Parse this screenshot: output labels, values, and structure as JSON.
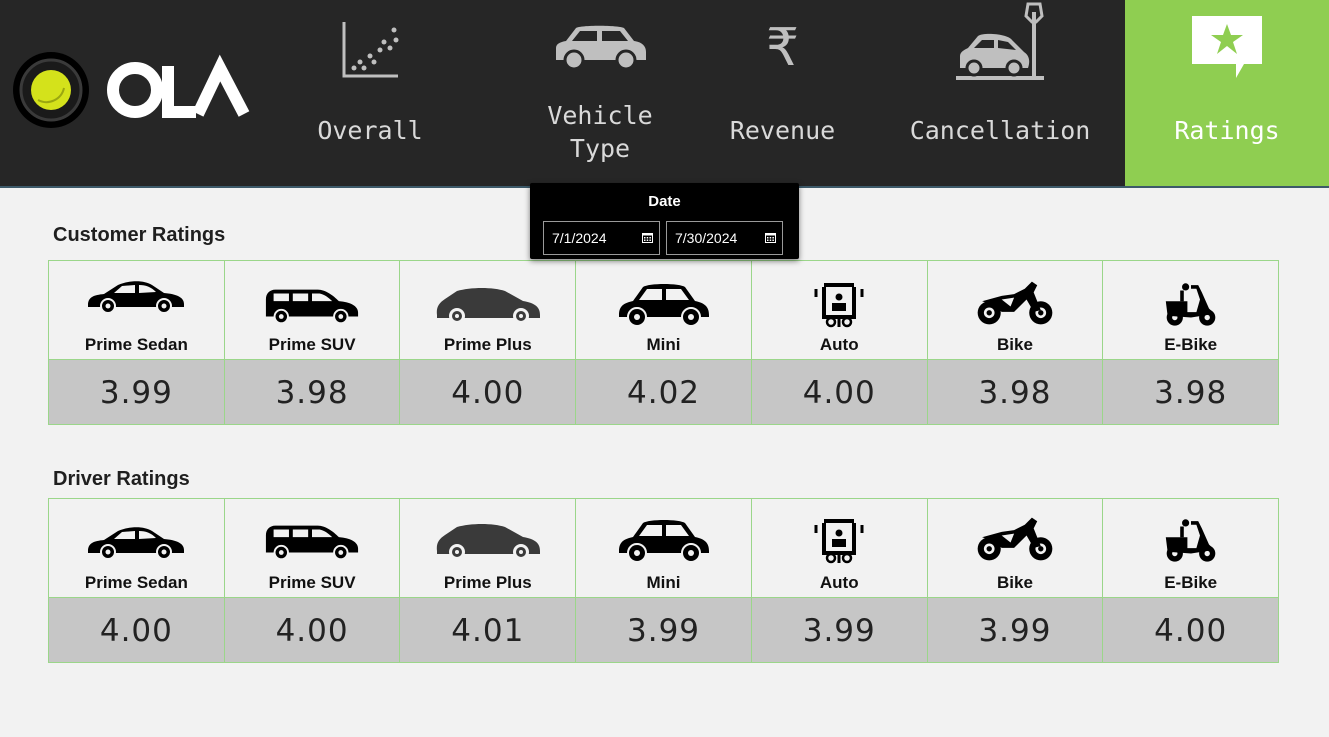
{
  "brand": {
    "name": "OLA"
  },
  "nav": {
    "overall": "Overall",
    "vehicle_line1": "Vehicle",
    "vehicle_line2": "Type",
    "revenue": "Revenue",
    "revenue_symbol": "₹",
    "cancellation": "Cancellation",
    "ratings": "Ratings",
    "active": "Ratings"
  },
  "date_filter": {
    "title": "Date",
    "start": "7/1/2024",
    "end": "7/30/2024"
  },
  "customer_ratings": {
    "title": "Customer Ratings",
    "items": [
      {
        "label": "Prime Sedan",
        "value": "3.99",
        "icon": "sedan-icon"
      },
      {
        "label": "Prime SUV",
        "value": "3.98",
        "icon": "suv-icon"
      },
      {
        "label": "Prime Plus",
        "value": "4.00",
        "icon": "prime-plus-car-icon"
      },
      {
        "label": "Mini",
        "value": "4.02",
        "icon": "mini-car-icon"
      },
      {
        "label": "Auto",
        "value": "4.00",
        "icon": "auto-rickshaw-icon"
      },
      {
        "label": "Bike",
        "value": "3.98",
        "icon": "motorbike-icon"
      },
      {
        "label": "E-Bike",
        "value": "3.98",
        "icon": "scooter-icon"
      }
    ]
  },
  "driver_ratings": {
    "title": "Driver Ratings",
    "items": [
      {
        "label": "Prime Sedan",
        "value": "4.00",
        "icon": "sedan-icon"
      },
      {
        "label": "Prime SUV",
        "value": "4.00",
        "icon": "suv-icon"
      },
      {
        "label": "Prime Plus",
        "value": "4.01",
        "icon": "prime-plus-car-icon"
      },
      {
        "label": "Mini",
        "value": "3.99",
        "icon": "mini-car-icon"
      },
      {
        "label": "Auto",
        "value": "3.99",
        "icon": "auto-rickshaw-icon"
      },
      {
        "label": "Bike",
        "value": "3.99",
        "icon": "motorbike-icon"
      },
      {
        "label": "E-Bike",
        "value": "4.00",
        "icon": "scooter-icon"
      }
    ]
  },
  "colors": {
    "header_bg": "#262626",
    "active_tab": "#8fce51",
    "grid_border": "#9bd68a",
    "value_bg": "#c6c6c6",
    "logo_yellow": "#d4e21b"
  }
}
